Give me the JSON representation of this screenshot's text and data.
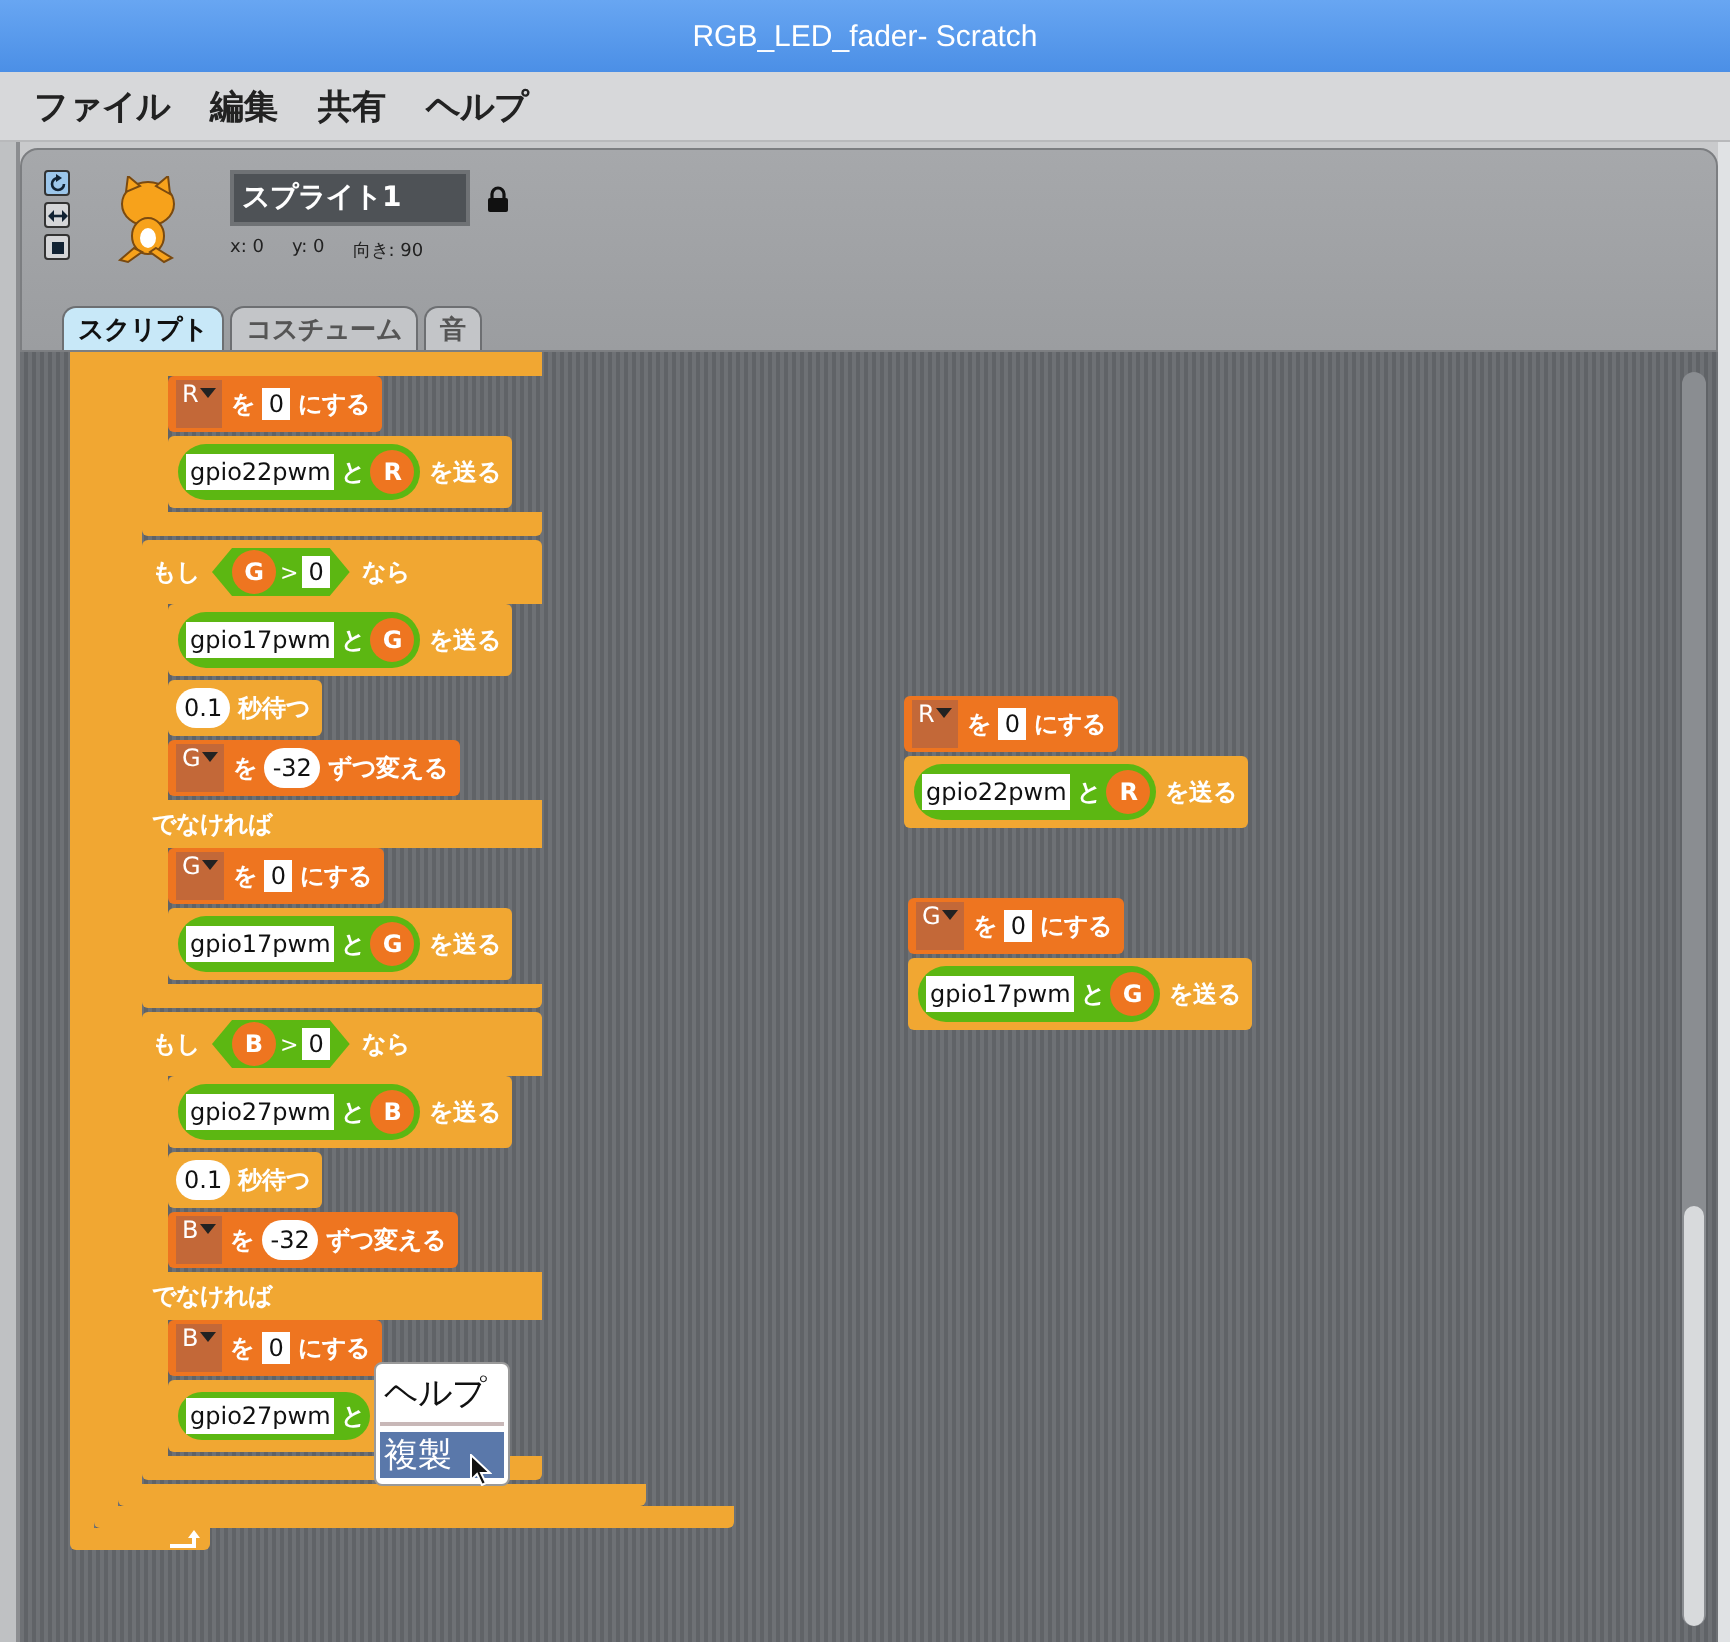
{
  "window": {
    "title": "RGB_LED_fader- Scratch"
  },
  "menu_bar": [
    "ファイル",
    "編集",
    "共有",
    "ヘルプ"
  ],
  "sprite": {
    "rotation_styles": [
      {
        "selected": true
      },
      {
        "selected": false
      },
      {
        "selected": false
      }
    ],
    "name": "スプライト1",
    "locked": true,
    "x": "x: 0",
    "y": "y: 0",
    "direction": "向き: 90"
  },
  "tabs": [
    {
      "label": "スクリプト",
      "selected": true
    },
    {
      "label": "コスチューム",
      "selected": false
    },
    {
      "label": "音",
      "selected": false
    }
  ],
  "scripts": [
    {
      "blocks": [
        {
          "kind": "c_block",
          "loop_arrow": true,
          "body": [
            {
              "kind": "c_block",
              "loop_arrow": false,
              "body": [
                {
                  "kind": "c_block",
                  "loop_arrow": false,
                  "body": [
                    {
                      "kind": "else_tail",
                      "else": [
                        {
                          "kind": "set",
                          "var": "R",
                          "particle": "を",
                          "value": "0",
                          "label": "にする"
                        },
                        {
                          "kind": "send",
                          "message": "gpio22pwm",
                          "particle": "と",
                          "var": "R",
                          "label": "を送る"
                        }
                      ]
                    },
                    {
                      "kind": "if_else",
                      "label": "もし",
                      "var": "G",
                      "op": ">",
                      "value": "0",
                      "label_end": "なら",
                      "then": [
                        {
                          "kind": "send",
                          "message": "gpio17pwm",
                          "particle": "と",
                          "var": "G",
                          "label": "を送る"
                        },
                        {
                          "kind": "wait",
                          "value": "0.1",
                          "label": "秒待つ"
                        },
                        {
                          "kind": "change",
                          "var": "G",
                          "particle": "を",
                          "value": "-32",
                          "label": "ずつ変える"
                        }
                      ],
                      "else_label": "でなければ",
                      "else": [
                        {
                          "kind": "set",
                          "var": "G",
                          "particle": "を",
                          "value": "0",
                          "label": "にする"
                        },
                        {
                          "kind": "send",
                          "message": "gpio17pwm",
                          "particle": "と",
                          "var": "G",
                          "label": "を送る"
                        }
                      ]
                    },
                    {
                      "kind": "if_else",
                      "label": "もし",
                      "var": "B",
                      "op": ">",
                      "value": "0",
                      "label_end": "なら",
                      "then": [
                        {
                          "kind": "send",
                          "message": "gpio27pwm",
                          "particle": "と",
                          "var": "B",
                          "label": "を送る"
                        },
                        {
                          "kind": "wait",
                          "value": "0.1",
                          "label": "秒待つ"
                        },
                        {
                          "kind": "change",
                          "var": "B",
                          "particle": "を",
                          "value": "-32",
                          "label": "ずつ変える"
                        }
                      ],
                      "else_label": "でなければ",
                      "else": [
                        {
                          "kind": "set",
                          "var": "B",
                          "particle": "を",
                          "value": "0",
                          "label": "にする"
                        },
                        {
                          "kind": "send",
                          "message": "gpio27pwm",
                          "particle": "と"
                        }
                      ]
                    }
                  ]
                }
              ]
            }
          ]
        }
      ]
    },
    {
      "blocks": [
        {
          "kind": "set",
          "var": "R",
          "particle": "を",
          "value": "0",
          "label": "にする"
        },
        {
          "kind": "send",
          "message": "gpio22pwm",
          "particle": "と",
          "var": "R",
          "label": "を送る"
        }
      ]
    },
    {
      "blocks": [
        {
          "kind": "set",
          "var": "G",
          "particle": "を",
          "value": "0",
          "label": "にする"
        },
        {
          "kind": "send",
          "message": "gpio17pwm",
          "particle": "と",
          "var": "G",
          "label": "を送る"
        }
      ]
    }
  ],
  "context_menu": {
    "items": [
      {
        "label": "ヘルプ",
        "selected": false
      },
      {
        "label": "複製",
        "selected": true
      }
    ]
  }
}
